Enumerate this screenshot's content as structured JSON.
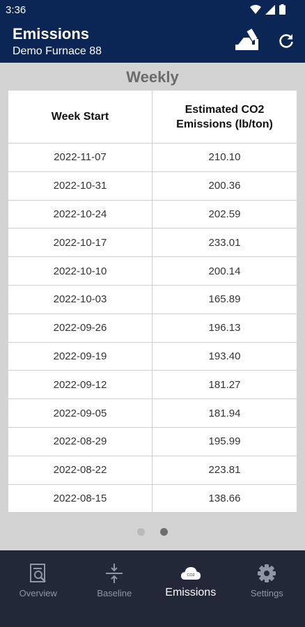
{
  "status_bar": {
    "time": "3:36"
  },
  "app_bar": {
    "title": "Emissions",
    "subtitle": "Demo Furnace 88"
  },
  "section": {
    "title": "Weekly"
  },
  "table": {
    "headers": [
      "Week Start",
      "Estimated CO2 Emissions (lb/ton)"
    ],
    "rows": [
      [
        "2022-11-07",
        "210.10"
      ],
      [
        "2022-10-31",
        "200.36"
      ],
      [
        "2022-10-24",
        "202.59"
      ],
      [
        "2022-10-17",
        "233.01"
      ],
      [
        "2022-10-10",
        "200.14"
      ],
      [
        "2022-10-03",
        "165.89"
      ],
      [
        "2022-09-26",
        "196.13"
      ],
      [
        "2022-09-19",
        "193.40"
      ],
      [
        "2022-09-12",
        "181.27"
      ],
      [
        "2022-09-05",
        "181.94"
      ],
      [
        "2022-08-29",
        "195.99"
      ],
      [
        "2022-08-22",
        "223.81"
      ],
      [
        "2022-08-15",
        "138.66"
      ]
    ]
  },
  "pager": {
    "pages": 2,
    "active_index": 1
  },
  "bottom_nav": {
    "items": [
      {
        "label": "Overview",
        "icon": "overview-icon"
      },
      {
        "label": "Baseline",
        "icon": "baseline-icon"
      },
      {
        "label": "Emissions",
        "icon": "co2-cloud-icon",
        "active": true
      },
      {
        "label": "Settings",
        "icon": "gear-icon"
      }
    ]
  },
  "colors": {
    "app_bar": "#0b2554",
    "background": "#d3d3d3",
    "nav_bar": "#232838",
    "section_title": "#6b6b6b"
  },
  "icons": {
    "cloud_text": "CO2"
  }
}
